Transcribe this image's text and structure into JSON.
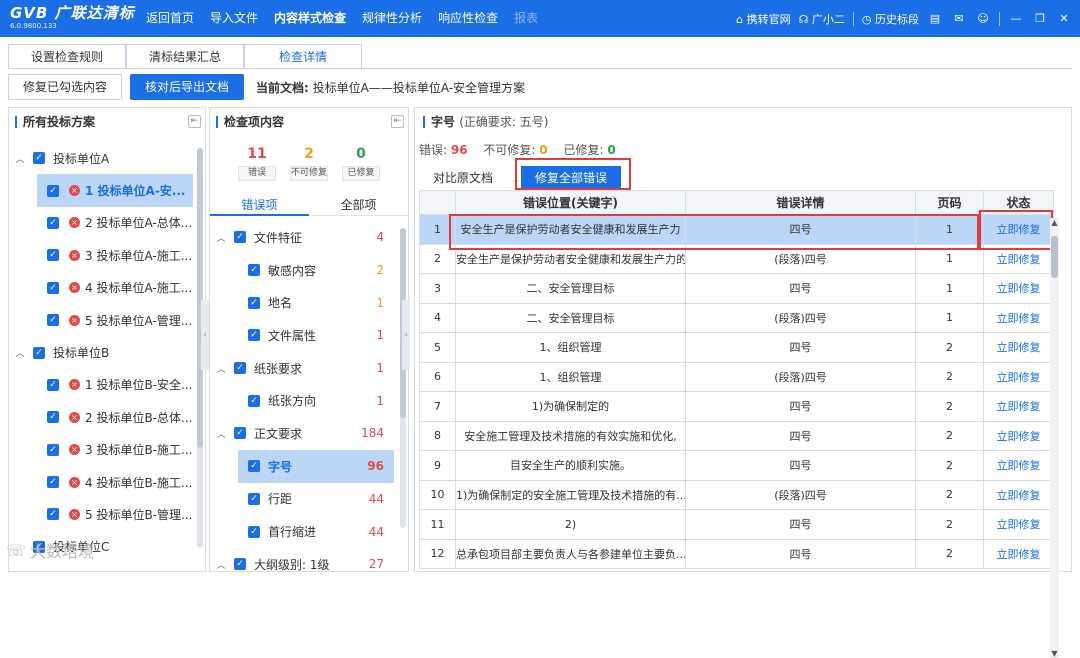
{
  "app": {
    "brand": "GVB 广联达清标",
    "version": "6.0.9800.133"
  },
  "nav": [
    "返回首页",
    "导入文件",
    "内容样式检查",
    "规律性分析",
    "响应性检查",
    "报表"
  ],
  "top_right": {
    "site": "携转官网",
    "assistant": "广小二",
    "history": "历史标段"
  },
  "tabs": [
    "设置检查规则",
    "清标结果汇总",
    "检查详情"
  ],
  "toolbar": {
    "fix_btn": "修复已勾选内容",
    "export_btn": "核对后导出文档",
    "current_doc_label": "当前文档:",
    "current_doc": "投标单位A——投标单位A-安全管理方案"
  },
  "left_panel": {
    "title": "所有投标方案",
    "groups": [
      {
        "name": "投标单位A",
        "items": [
          "1 投标单位A-安...",
          "2 投标单位A-总体...",
          "3 投标单位A-施工...",
          "4 投标单位A-施工...",
          "5 投标单位A-管理..."
        ]
      },
      {
        "name": "投标单位B",
        "items": [
          "1 投标单位B-安全...",
          "2 投标单位B-总体...",
          "3 投标单位B-施工...",
          "4 投标单位B-施工...",
          "5 投标单位B-管理..."
        ]
      }
    ],
    "footer_partial": "投标单位C"
  },
  "mid_panel": {
    "title": "检查项内容",
    "stats": [
      {
        "num": "11",
        "label": "错误"
      },
      {
        "num": "2",
        "label": "不可修复"
      },
      {
        "num": "0",
        "label": "已修复"
      }
    ],
    "tabs": [
      "错误项",
      "全部项"
    ],
    "items": [
      {
        "label": "文件特征",
        "count": "4",
        "level": 0
      },
      {
        "label": "敏感内容",
        "count": "2",
        "level": 1
      },
      {
        "label": "地名",
        "count": "1",
        "level": 1
      },
      {
        "label": "文件属性",
        "count": "1",
        "level": 1
      },
      {
        "label": "纸张要求",
        "count": "1",
        "level": 0
      },
      {
        "label": "纸张方向",
        "count": "1",
        "level": 1
      },
      {
        "label": "正文要求",
        "count": "184",
        "level": 0
      },
      {
        "label": "字号",
        "count": "96",
        "level": 1
      },
      {
        "label": "行距",
        "count": "44",
        "level": 1
      },
      {
        "label": "首行缩进",
        "count": "44",
        "level": 1
      },
      {
        "label": "大纲级别: 1级",
        "count": "27",
        "level": 0
      }
    ]
  },
  "right_panel": {
    "title": "字号",
    "requirement": "(正确要求: 五号)",
    "errors_label": "错误:",
    "errors": "96",
    "unfixable_label": "不可修复:",
    "unfixable": "0",
    "fixed_label": "已修复:",
    "fixed": "0",
    "compare_tab": "对比原文档",
    "fix_all_btn": "修复全部错误",
    "columns": [
      "",
      "错误位置(关键字)",
      "错误详情",
      "页码",
      "状态"
    ],
    "rows": [
      {
        "no": "1",
        "pos": "安全生产是保护劳动者安全健康和发展生产力",
        "detail": "四号",
        "page": "1",
        "status": "立即修复"
      },
      {
        "no": "2",
        "pos": "安全生产是保护劳动者安全健康和发展生产力的...",
        "detail": "(段落)四号",
        "page": "1",
        "status": "立即修复"
      },
      {
        "no": "3",
        "pos": "二、安全管理目标",
        "detail": "四号",
        "page": "1",
        "status": "立即修复"
      },
      {
        "no": "4",
        "pos": "二、安全管理目标",
        "detail": "(段落)四号",
        "page": "1",
        "status": "立即修复"
      },
      {
        "no": "5",
        "pos": "1、组织管理",
        "detail": "四号",
        "page": "2",
        "status": "立即修复"
      },
      {
        "no": "6",
        "pos": "1、组织管理",
        "detail": "(段落)四号",
        "page": "2",
        "status": "立即修复"
      },
      {
        "no": "7",
        "pos": "1)为确保制定的",
        "detail": "四号",
        "page": "2",
        "status": "立即修复"
      },
      {
        "no": "8",
        "pos": "安全施工管理及技术措施的有效实施和优化,",
        "detail": "四号",
        "page": "2",
        "status": "立即修复"
      },
      {
        "no": "9",
        "pos": "目安全生产的顺利实施。",
        "detail": "四号",
        "page": "2",
        "status": "立即修复"
      },
      {
        "no": "10",
        "pos": "1)为确保制定的安全施工管理及技术措施的有...",
        "detail": "(段落)四号",
        "page": "2",
        "status": "立即修复"
      },
      {
        "no": "11",
        "pos": "2)",
        "detail": "四号",
        "page": "2",
        "status": "立即修复"
      },
      {
        "no": "12",
        "pos": "总承包项目部主要负责人与各参建单位主要负...",
        "detail": "四号",
        "page": "2",
        "status": "立即修复"
      }
    ]
  },
  "watermark": "大数培境"
}
